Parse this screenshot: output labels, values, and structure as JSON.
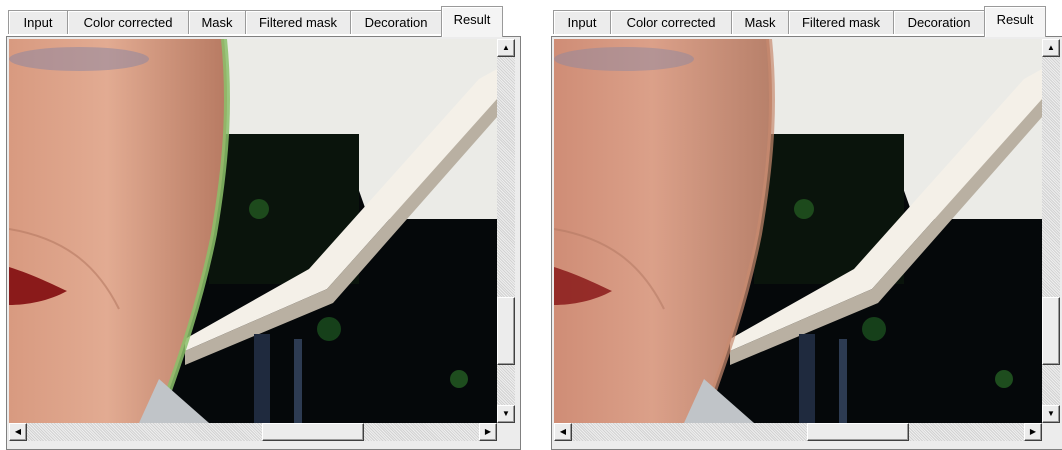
{
  "tabs": [
    "Input",
    "Color corrected",
    "Mask",
    "Filtered mask",
    "Decoration",
    "Result"
  ],
  "active_tab": "Result",
  "panels": [
    {
      "variant": "before",
      "description_colors": {
        "skin": "#d99a80",
        "halo": "#8bbf6a"
      },
      "vscroll_position": 0.78,
      "hscroll_position": 0.55
    },
    {
      "variant": "after",
      "description_colors": {
        "skin": "#d4927c",
        "halo": "#c88a6f"
      },
      "vscroll_position": 0.78,
      "hscroll_position": 0.55
    }
  ],
  "icons": {
    "up": "scroll-up-arrow-icon",
    "down": "scroll-down-arrow-icon",
    "left": "scroll-left-arrow-icon",
    "right": "scroll-right-arrow-icon"
  },
  "glyphs": {
    "up": "▲",
    "down": "▼",
    "left": "◀",
    "right": "▶"
  }
}
